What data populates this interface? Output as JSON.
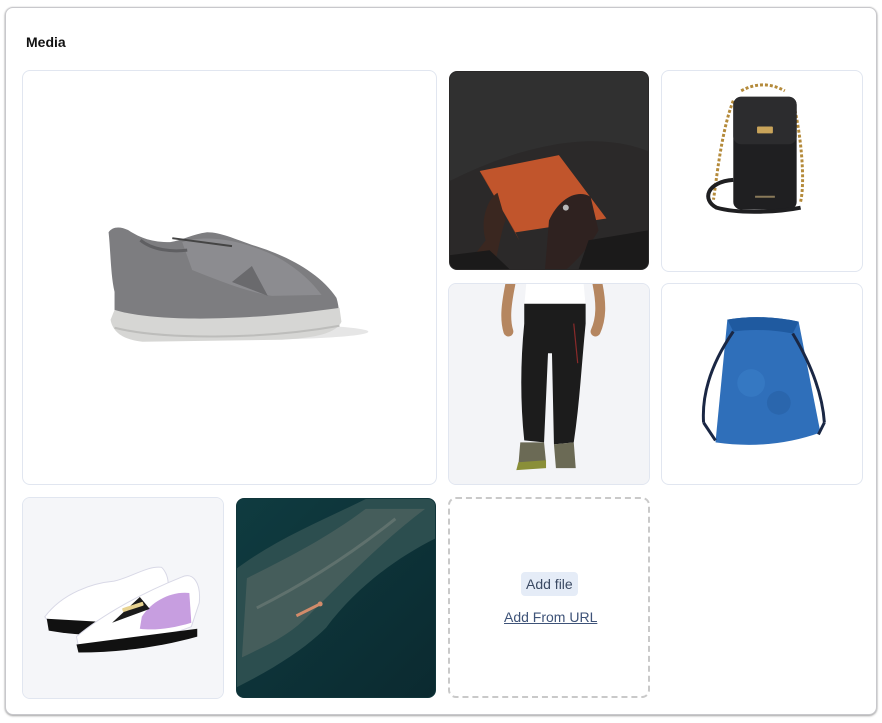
{
  "card": {
    "title": "Media"
  },
  "media": [
    {
      "name": "grey-running-sneaker",
      "alt": "Grey running sneaker"
    },
    {
      "name": "orange-leather-folio",
      "alt": "Hands holding orange leather folio"
    },
    {
      "name": "black-chain-crossbody-bag",
      "alt": "Black crossbody bag with gold chain"
    },
    {
      "name": "black-hiking-pants",
      "alt": "Black hiking pants"
    },
    {
      "name": "blue-drawstring-bag",
      "alt": "Blue drawstring backpack"
    },
    {
      "name": "purple-white-sneakers",
      "alt": "Pair of white, black and purple sneakers"
    },
    {
      "name": "aerial-ocean-swimmer",
      "alt": "Aerial view of ocean and swimmer"
    }
  ],
  "dropzone": {
    "add_file_label": "Add file",
    "add_url_label": "Add From URL"
  },
  "colors": {
    "accent_bg": "#e5ecf7",
    "link": "#3e5378",
    "tile_border": "#e1e6f0"
  }
}
